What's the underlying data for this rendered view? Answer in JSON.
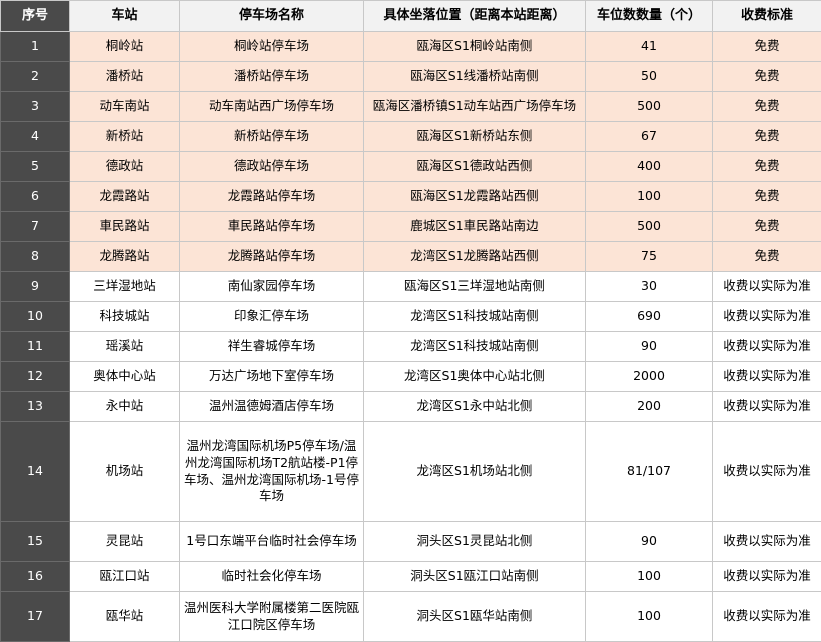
{
  "table": {
    "headers": [
      "序号",
      "车站",
      "停车场名称",
      "具体坐落位置（距离本站距离）",
      "车位数数量（个）",
      "收费标准"
    ],
    "rows": [
      {
        "idx": "1",
        "station": "桐岭站",
        "lot": "桐岭站停车场",
        "location": "瓯海区S1桐岭站南侧",
        "spaces": "41",
        "fee": "免费",
        "highlight": true
      },
      {
        "idx": "2",
        "station": "潘桥站",
        "lot": "潘桥站停车场",
        "location": "瓯海区S1线潘桥站南侧",
        "spaces": "50",
        "fee": "免费",
        "highlight": true
      },
      {
        "idx": "3",
        "station": "动车南站",
        "lot": "动车南站西广场停车场",
        "location": "瓯海区潘桥镇S1动车站西广场停车场",
        "spaces": "500",
        "fee": "免费",
        "highlight": true
      },
      {
        "idx": "4",
        "station": "新桥站",
        "lot": "新桥站停车场",
        "location": "瓯海区S1新桥站东侧",
        "spaces": "67",
        "fee": "免费",
        "highlight": true
      },
      {
        "idx": "5",
        "station": "德政站",
        "lot": "德政站停车场",
        "location": "瓯海区S1德政站西侧",
        "spaces": "400",
        "fee": "免费",
        "highlight": true
      },
      {
        "idx": "6",
        "station": "龙霞路站",
        "lot": "龙霞路站停车场",
        "location": "瓯海区S1龙霞路站西侧",
        "spaces": "100",
        "fee": "免费",
        "highlight": true
      },
      {
        "idx": "7",
        "station": "車民路站",
        "lot": "車民路站停车场",
        "location": "鹿城区S1車民路站南边",
        "spaces": "500",
        "fee": "免费",
        "highlight": true
      },
      {
        "idx": "8",
        "station": "龙腾路站",
        "lot": "龙腾路站停车场",
        "location": "龙湾区S1龙腾路站西侧",
        "spaces": "75",
        "fee": "免费",
        "highlight": true
      },
      {
        "idx": "9",
        "station": "三垟湿地站",
        "lot": "南仙家园停车场",
        "location": "瓯海区S1三垟湿地站南侧",
        "spaces": "30",
        "fee": "收费以实际为准",
        "highlight": false
      },
      {
        "idx": "10",
        "station": "科技城站",
        "lot": "印象汇停车场",
        "location": "龙湾区S1科技城站南侧",
        "spaces": "690",
        "fee": "收费以实际为准",
        "highlight": false
      },
      {
        "idx": "11",
        "station": "瑶溪站",
        "lot": "祥生睿城停车场",
        "location": "龙湾区S1科技城站南侧",
        "spaces": "90",
        "fee": "收费以实际为准",
        "highlight": false
      },
      {
        "idx": "12",
        "station": "奥体中心站",
        "lot": "万达广场地下室停车场",
        "location": "龙湾区S1奥体中心站北侧",
        "spaces": "2000",
        "fee": "收费以实际为准",
        "highlight": false
      },
      {
        "idx": "13",
        "station": "永中站",
        "lot": "温州温德姆酒店停车场",
        "location": "龙湾区S1永中站北侧",
        "spaces": "200",
        "fee": "收费以实际为准",
        "highlight": false
      },
      {
        "idx": "14",
        "station": "机场站",
        "lot": "温州龙湾国际机场P5停车场/温州龙湾国际机场T2航站楼-P1停车场、温州龙湾国际机场-1号停车场",
        "location": "龙湾区S1机场站北侧",
        "spaces": "81/107",
        "fee": "收费以实际为准",
        "highlight": false
      },
      {
        "idx": "15",
        "station": "灵昆站",
        "lot": "1号口东端平台临时社会停车场",
        "location": "洞头区S1灵昆站北侧",
        "spaces": "90",
        "fee": "收费以实际为准",
        "highlight": false
      },
      {
        "idx": "16",
        "station": "瓯江口站",
        "lot": "临时社会化停车场",
        "location": "洞头区S1瓯江口站南侧",
        "spaces": "100",
        "fee": "收费以实际为准",
        "highlight": false
      },
      {
        "idx": "17",
        "station": "瓯华站",
        "lot": "温州医科大学附属楼第二医院瓯江口院区停车场",
        "location": "洞头区S1瓯华站南侧",
        "spaces": "100",
        "fee": "收费以实际为准",
        "highlight": false
      }
    ]
  }
}
